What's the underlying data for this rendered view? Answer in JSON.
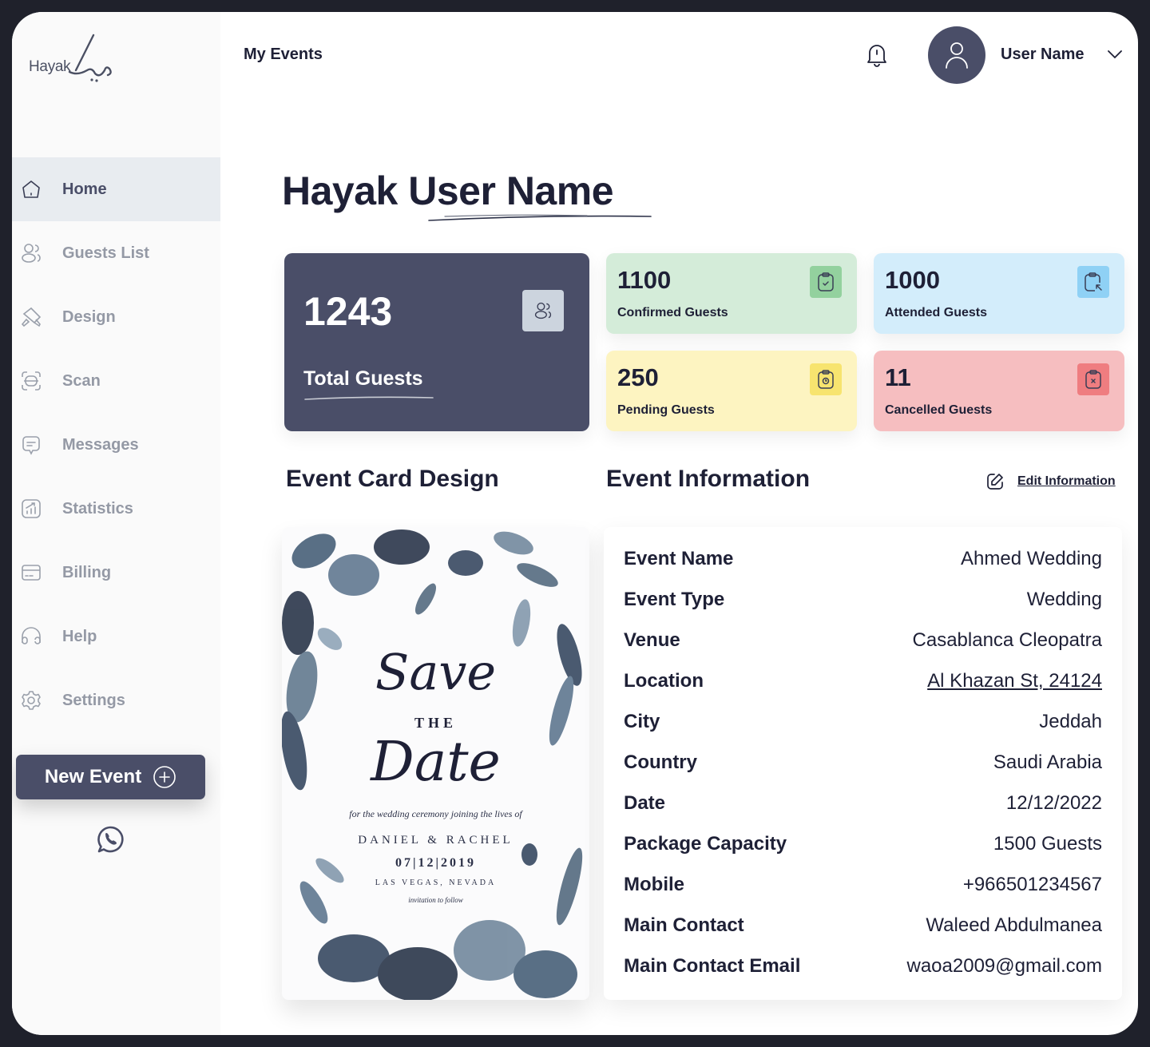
{
  "brand": {
    "name": "Hayak",
    "arabic": "حياك"
  },
  "header": {
    "breadcrumb": "My Events",
    "user_name": "User Name"
  },
  "sidebar": {
    "items": [
      {
        "label": "Home",
        "icon": "home-icon",
        "active": true
      },
      {
        "label": "Guests List",
        "icon": "users-icon"
      },
      {
        "label": "Design",
        "icon": "design-icon"
      },
      {
        "label": "Scan",
        "icon": "scan-icon"
      },
      {
        "label": "Messages",
        "icon": "message-icon"
      },
      {
        "label": "Statistics",
        "icon": "statistics-icon"
      },
      {
        "label": "Billing",
        "icon": "billing-icon"
      },
      {
        "label": "Help",
        "icon": "headphones-icon"
      },
      {
        "label": "Settings",
        "icon": "gear-icon"
      }
    ],
    "new_event_label": "New Event"
  },
  "greeting": {
    "prefix": "Hayak",
    "name": "User Name"
  },
  "stats": {
    "total": {
      "value": "1243",
      "label": "Total Guests"
    },
    "confirmed": {
      "value": "1100",
      "label": "Confirmed Guests",
      "color": "#d4ecd9"
    },
    "attended": {
      "value": "1000",
      "label": "Attended Guests",
      "color": "#d3edfb"
    },
    "pending": {
      "value": "250",
      "label": "Pending Guests",
      "color": "#fdf4c1"
    },
    "cancelled": {
      "value": "11",
      "label": "Cancelled Guests",
      "color": "#f6bec0"
    }
  },
  "sections": {
    "card_design": "Event Card Design",
    "event_info": "Event Information",
    "edit_label": "Edit Information"
  },
  "invitation": {
    "save": "Save",
    "the": "THE",
    "date": "Date",
    "for_line": "for the wedding ceremony joining the lives of",
    "names": "DANIEL & RACHEL",
    "when": "07|12|2019",
    "place": "LAS VEGAS, NEVADA",
    "follow": "invitation to follow"
  },
  "event_info": [
    {
      "label": "Event Name",
      "value": "Ahmed Wedding"
    },
    {
      "label": "Event Type",
      "value": "Wedding"
    },
    {
      "label": "Venue",
      "value": "Casablanca Cleopatra"
    },
    {
      "label": "Location",
      "value": "Al Khazan St, 24124",
      "link": true
    },
    {
      "label": "City",
      "value": "Jeddah"
    },
    {
      "label": "Country",
      "value": "Saudi Arabia"
    },
    {
      "label": "Date",
      "value": "12/12/2022"
    },
    {
      "label": "Package Capacity",
      "value": "1500 Guests"
    },
    {
      "label": "Mobile",
      "value": "+966501234567"
    },
    {
      "label": "Main Contact",
      "value": "Waleed Abdulmanea"
    },
    {
      "label": "Main Contact Email",
      "value": "waoa2009@gmail.com"
    }
  ],
  "colors": {
    "primary": "#4a4e68",
    "text": "#1e2036",
    "muted": "#9499a5"
  }
}
